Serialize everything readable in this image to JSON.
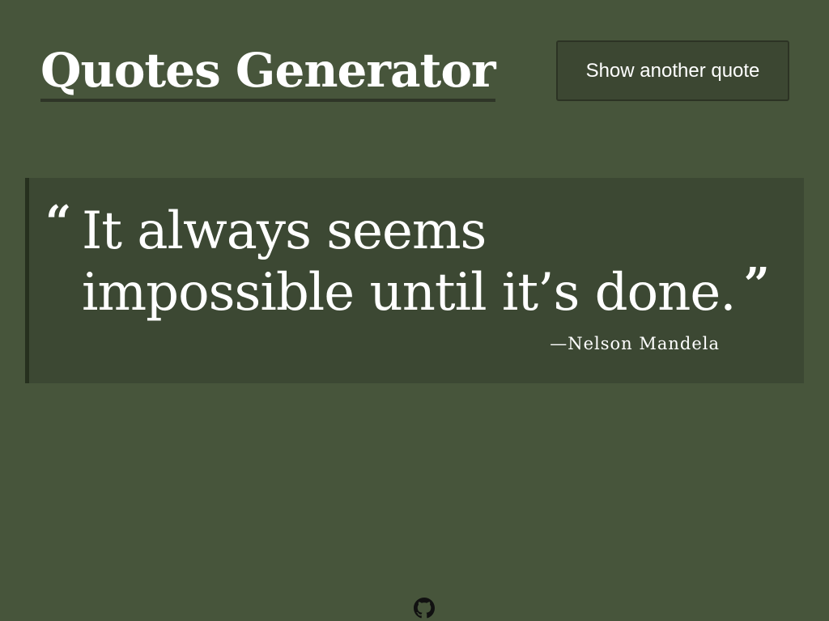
{
  "header": {
    "title": "Quotes Generator",
    "next_button_label": "Show another quote"
  },
  "quote": {
    "open_mark": "“",
    "text": "It always seems impossible until it’s done.",
    "close_mark": "”",
    "author": "—Nelson Mandela"
  },
  "footer": {
    "icon": "github-icon"
  },
  "colors": {
    "background": "#47553b",
    "card": "#3c4833",
    "card_border": "#26301e",
    "text": "#ffffff"
  }
}
